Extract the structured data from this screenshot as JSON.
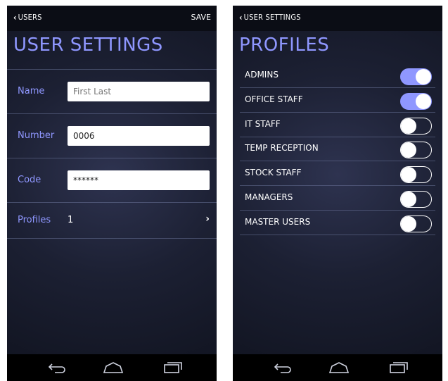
{
  "user_settings": {
    "back_label": "USERS",
    "save_label": "SAVE",
    "title": "USER SETTINGS",
    "name": {
      "label": "Name",
      "placeholder": "First Last"
    },
    "number": {
      "label": "Number",
      "value": "0006"
    },
    "code": {
      "label": "Code",
      "value": "******"
    },
    "profiles": {
      "label": "Profiles",
      "value": "1"
    }
  },
  "profiles_screen": {
    "back_label": "USER SETTINGS",
    "title": "PROFILES",
    "items": [
      {
        "label": "ADMINS",
        "on": true
      },
      {
        "label": "OFFICE STAFF",
        "on": true
      },
      {
        "label": "IT STAFF",
        "on": false
      },
      {
        "label": "TEMP RECEPTION",
        "on": false
      },
      {
        "label": "STOCK STAFF",
        "on": false
      },
      {
        "label": "MANAGERS",
        "on": false
      },
      {
        "label": "MASTER USERS",
        "on": false
      }
    ]
  },
  "colors": {
    "accent": "#8f97ff",
    "background": "#1c2033",
    "bar": "#0b0d15"
  },
  "icons": {
    "back": "chevron-left-icon",
    "forward": "chevron-right-icon",
    "nav_back": "back-arrow-icon",
    "nav_home": "home-icon",
    "nav_recent": "recent-apps-icon"
  }
}
